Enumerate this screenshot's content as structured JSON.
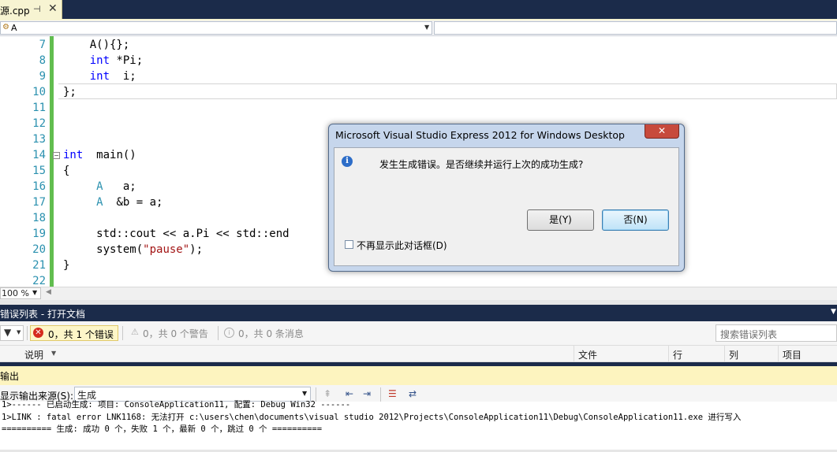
{
  "tab": {
    "title": "源.cpp",
    "pin": "⊣",
    "close": "✕"
  },
  "navbar": {
    "scope": "A",
    "icon": "class-icon"
  },
  "editor": {
    "lines": [
      {
        "num": "7",
        "tokens": [
          {
            "t": "    A(){};",
            "c": ""
          }
        ]
      },
      {
        "num": "8",
        "tokens": [
          {
            "t": "    ",
            "c": ""
          },
          {
            "t": "int",
            "c": "kw"
          },
          {
            "t": " *Pi;",
            "c": ""
          }
        ]
      },
      {
        "num": "9",
        "tokens": [
          {
            "t": "    ",
            "c": ""
          },
          {
            "t": "int",
            "c": "kw"
          },
          {
            "t": "  i;",
            "c": ""
          }
        ]
      },
      {
        "num": "10",
        "tokens": [
          {
            "t": "};",
            "c": ""
          }
        ]
      },
      {
        "num": "11",
        "tokens": []
      },
      {
        "num": "12",
        "tokens": []
      },
      {
        "num": "13",
        "tokens": []
      },
      {
        "num": "14",
        "tokens": [
          {
            "t": "int",
            "c": "kw"
          },
          {
            "t": "  main()",
            "c": ""
          }
        ]
      },
      {
        "num": "15",
        "tokens": [
          {
            "t": "{",
            "c": ""
          }
        ]
      },
      {
        "num": "16",
        "tokens": [
          {
            "t": "     ",
            "c": ""
          },
          {
            "t": "A",
            "c": "ty"
          },
          {
            "t": "   a;",
            "c": ""
          }
        ]
      },
      {
        "num": "17",
        "tokens": [
          {
            "t": "     ",
            "c": ""
          },
          {
            "t": "A",
            "c": "ty"
          },
          {
            "t": "  &b = a;",
            "c": ""
          }
        ]
      },
      {
        "num": "18",
        "tokens": []
      },
      {
        "num": "19",
        "tokens": [
          {
            "t": "     std::cout << a.Pi << std::end",
            "c": ""
          }
        ]
      },
      {
        "num": "20",
        "tokens": [
          {
            "t": "     system(",
            "c": ""
          },
          {
            "t": "\"pause\"",
            "c": "str"
          },
          {
            "t": ");",
            "c": ""
          }
        ]
      },
      {
        "num": "21",
        "tokens": [
          {
            "t": "}",
            "c": ""
          }
        ]
      },
      {
        "num": "22",
        "tokens": []
      }
    ],
    "zoom": "100 %"
  },
  "error_list": {
    "title": "错误列表 - 打开文档",
    "errors_label": "0，共 1 个错误",
    "warnings_label": "0，共 0 个警告",
    "messages_label": "0，共 0 条消息",
    "search_placeholder": "搜索错误列表",
    "columns": [
      "说明",
      "文件",
      "行",
      "列",
      "项目"
    ]
  },
  "output": {
    "title": "输出",
    "source_label": "显示输出来源(S):",
    "source_value": "生成",
    "lines": [
      "1>------ 已启动生成: 项目: ConsoleApplication11, 配置: Debug Win32 ------",
      "1>LINK : fatal error LNK1168: 无法打开 c:\\users\\chen\\documents\\visual studio 2012\\Projects\\ConsoleApplication11\\Debug\\ConsoleApplication11.exe 进行写入",
      "========== 生成: 成功 0 个，失败 1 个，最新 0 个，跳过 0 个 =========="
    ]
  },
  "dialog": {
    "title": "Microsoft Visual Studio Express 2012 for Windows Desktop",
    "message": "发生生成错误。是否继续并运行上次的成功生成?",
    "yes_label": "是(Y)",
    "no_label": "否(N)",
    "checkbox_label": "不再显示此对话框(D)",
    "checkbox_checked": false,
    "close": "✕"
  },
  "colors": {
    "accent_dark": "#1b2b4a",
    "tab_active": "#f7f4d2",
    "change_bar": "#61bd4f",
    "keyword": "#0000ff",
    "type": "#2b91af",
    "string": "#a31515",
    "error_red": "#d52b1e"
  }
}
